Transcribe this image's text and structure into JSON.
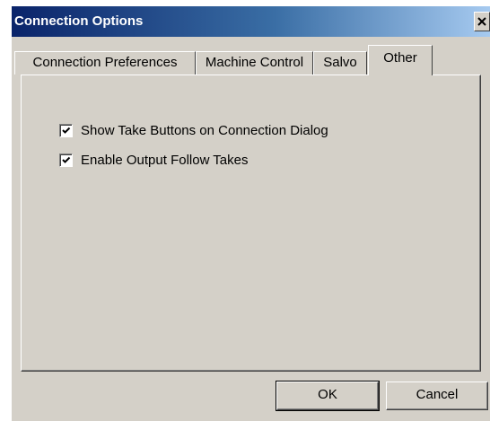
{
  "window": {
    "title": "Connection Options"
  },
  "tabs": [
    {
      "label": "Connection Preferences",
      "active": false
    },
    {
      "label": "Machine Control",
      "active": false
    },
    {
      "label": "Salvo",
      "active": false
    },
    {
      "label": "Other",
      "active": true
    }
  ],
  "options": [
    {
      "label": "Show Take Buttons on Connection Dialog",
      "checked": true
    },
    {
      "label": "Enable Output Follow Takes",
      "checked": true
    }
  ],
  "buttons": {
    "ok_label": "OK",
    "cancel_label": "Cancel"
  },
  "colors": {
    "dialog_face": "#d4d0c8",
    "titlebar_start": "#0a246a",
    "titlebar_end": "#a6caf0"
  },
  "icons": {
    "close": "close-icon",
    "check": "checkmark-icon"
  }
}
